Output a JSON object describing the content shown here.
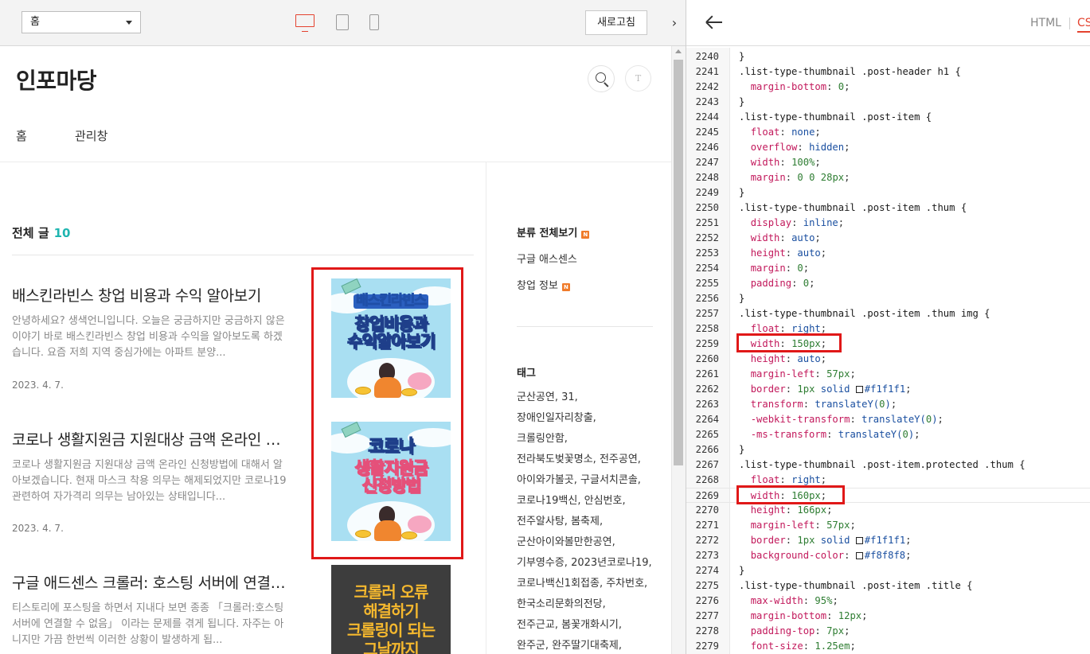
{
  "preview": {
    "page_select": "홈",
    "refresh_label": "새로고침",
    "collapse_arrow": "›",
    "blog_title": "인포마당",
    "profile_initial": "T",
    "nav": [
      "홈",
      "관리창"
    ],
    "posts_header": "전체 글",
    "posts_count": "10",
    "posts": [
      {
        "title": "배스킨라빈스 창업 비용과 수익 알아보기",
        "excerpt": "안녕하세요? 생색언니입니다. 오늘은 궁금하지만 궁금하지 않은 이야기 바로 배스킨라빈스 창업 비용과 수익을 알아보도록 하겠습니다. 요즘 저희 지역 중심가에는 아파트 분양...",
        "date": "2023. 4. 7.",
        "thumb_lines": [
          "배스킨라빈스",
          "창업비용과",
          "수익알아보기"
        ]
      },
      {
        "title": "코로나 생활지원금 지원대상 금액 온라인 신청방법",
        "excerpt": "코로나 생활지원금 지원대상 금액 온라인 신청방법에 대해서 알아보겠습니다. 현재 마스크 착용 의무는 해제되었지만 코로나19 관련하여 자가격리 의무는 남아있는 상태입니다...",
        "date": "2023. 4. 7.",
        "thumb_lines": [
          "코로나",
          "생활지원금",
          "신청방법"
        ]
      },
      {
        "title": "구글 애드센스 크롤러: 호스팅 서버에 연결할 수 없음",
        "excerpt": "티스토리에 포스팅을 하면서 지내다 보면 종종 「크롤러:호스팅 서버에 연결할 수 없음」 이라는 문제를 겪게 됩니다. 자주는 아니지만 가끔 한번씩 이러한 상황이 발생하게 됩...",
        "date": "",
        "thumb_lines": [
          "크롤러 오류",
          "해결하기",
          "크롤링이 되는",
          "그날까지"
        ]
      }
    ],
    "sidebar": {
      "category_head": "분류 전체보기",
      "new_badge": "N",
      "categories": [
        {
          "label": "구글 애스센스",
          "new": false
        },
        {
          "label": "창업 정보",
          "new": true
        }
      ],
      "tag_head": "태그",
      "tag_lines": [
        "군산공연,  31,",
        "장애인일자리창출,",
        "크롤링안함,",
        "전라북도벚꽃명소,  전주공연,",
        "아이와가볼곳,  구글서치콘솔,",
        "코로나19백신,  안심번호,",
        "전주알사탕,  봄축제,",
        "군산아이와볼만한공연,",
        "기부영수증,  2023년코로나19,",
        "코로나백신1회접종,  주차번호,",
        "한국소리문화의전당,",
        "전주근교,  봄꽃개화시기,",
        "완주군,  완주딸기대축제,"
      ]
    }
  },
  "editor": {
    "tab_html": "HTML",
    "tab_css": "CSS",
    "active_line": 2269,
    "lines": [
      {
        "n": "2240",
        "t": "}"
      },
      {
        "n": "2241",
        "t": ".list-type-thumbnail .post-header h1 {"
      },
      {
        "n": "2242",
        "t": "  margin-bottom: 0;"
      },
      {
        "n": "2243",
        "t": "}"
      },
      {
        "n": "2244",
        "t": ".list-type-thumbnail .post-item {"
      },
      {
        "n": "2245",
        "t": "  float: none;"
      },
      {
        "n": "2246",
        "t": "  overflow: hidden;"
      },
      {
        "n": "2247",
        "t": "  width: 100%;"
      },
      {
        "n": "2248",
        "t": "  margin: 0 0 28px;"
      },
      {
        "n": "2249",
        "t": "}"
      },
      {
        "n": "2250",
        "t": ".list-type-thumbnail .post-item .thum {"
      },
      {
        "n": "2251",
        "t": "  display: inline;"
      },
      {
        "n": "2252",
        "t": "  width: auto;"
      },
      {
        "n": "2253",
        "t": "  height: auto;"
      },
      {
        "n": "2254",
        "t": "  margin: 0;"
      },
      {
        "n": "2255",
        "t": "  padding: 0;"
      },
      {
        "n": "2256",
        "t": "}"
      },
      {
        "n": "2257",
        "t": ".list-type-thumbnail .post-item .thum img {"
      },
      {
        "n": "2258",
        "t": "  float: right;"
      },
      {
        "n": "2259",
        "t": "  width: 150px;"
      },
      {
        "n": "2260",
        "t": "  height: auto;"
      },
      {
        "n": "2261",
        "t": "  margin-left: 57px;"
      },
      {
        "n": "2262",
        "t": "  border: 1px solid #f1f1f1;"
      },
      {
        "n": "2263",
        "t": "  transform: translateY(0);"
      },
      {
        "n": "2264",
        "t": "  -webkit-transform: translateY(0);"
      },
      {
        "n": "2265",
        "t": "  -ms-transform: translateY(0);"
      },
      {
        "n": "2266",
        "t": "}"
      },
      {
        "n": "2267",
        "t": ".list-type-thumbnail .post-item.protected .thum {"
      },
      {
        "n": "2268",
        "t": "  float: right;"
      },
      {
        "n": "2269",
        "t": "  width: 160px;"
      },
      {
        "n": "2270",
        "t": "  height: 166px;"
      },
      {
        "n": "2271",
        "t": "  margin-left: 57px;"
      },
      {
        "n": "2272",
        "t": "  border: 1px solid #f1f1f1;"
      },
      {
        "n": "2273",
        "t": "  background-color: #f8f8f8;"
      },
      {
        "n": "2274",
        "t": "}"
      },
      {
        "n": "2275",
        "t": ".list-type-thumbnail .post-item .title {"
      },
      {
        "n": "2276",
        "t": "  max-width: 95%;"
      },
      {
        "n": "2277",
        "t": "  margin-bottom: 12px;"
      },
      {
        "n": "2278",
        "t": "  padding-top: 7px;"
      },
      {
        "n": "2279",
        "t": "  font-size: 1.25em;"
      }
    ]
  },
  "colors": {
    "accent_red": "#e4422f",
    "annotation_red": "#e01818",
    "count_teal": "#1fb5b0",
    "badge_orange": "#f07b2a"
  },
  "icons": [
    "desktop-icon",
    "tablet-icon",
    "mobile-icon",
    "search-icon",
    "back-arrow-icon",
    "chevron-right-icon"
  ]
}
